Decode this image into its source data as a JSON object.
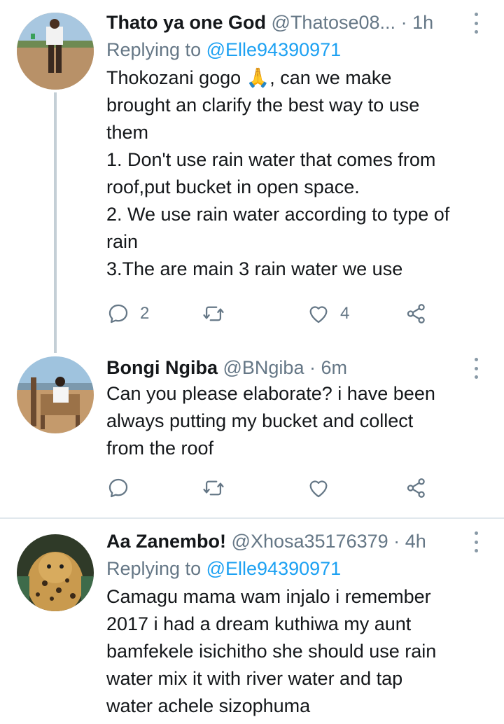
{
  "tweets": [
    {
      "name": "Thato ya one God",
      "handle": "@Thatose08...",
      "dot": "·",
      "time": "1h",
      "replying_prefix": "Replying to",
      "replying_to": "@Elle94390971",
      "lines": [
        "Thokozani gogo 🙏, can we make",
        "brought an clarify the best way to use",
        "them",
        "1. Don't use rain water that comes from",
        "roof,put bucket in open space.",
        "2. We use rain water according to type of",
        "rain",
        "3.The are main 3 rain water we use"
      ],
      "reply_count": "2",
      "retweet_count": "",
      "like_count": "4"
    },
    {
      "name": "Bongi Ngiba",
      "handle": "@BNgiba",
      "dot": "·",
      "time": "6m",
      "lines": [
        "Can you please elaborate? i have been",
        "always putting my bucket and collect",
        "from the roof"
      ],
      "reply_count": "",
      "retweet_count": "",
      "like_count": ""
    },
    {
      "name": "Aa Zanembo!",
      "handle": "@Xhosa35176379",
      "dot": "·",
      "time": "4h",
      "replying_prefix": "Replying to",
      "replying_to": "@Elle94390971",
      "lines": [
        "Camagu mama wam injalo i remember",
        "2017 i had a dream kuthiwa my aunt",
        "bamfekele isichitho she should use rain",
        "water mix it with river water and tap",
        "water achele sizophuma"
      ]
    }
  ],
  "icons": {
    "reply": "reply-icon",
    "retweet": "retweet-icon",
    "like": "like-icon",
    "share": "share-icon",
    "more": "more-options-icon"
  },
  "colors": {
    "link": "#1da1f2",
    "secondary_text": "#657786",
    "icon": "#657786",
    "thread_line": "#c4cfd6",
    "divider": "#e1e8ed"
  }
}
